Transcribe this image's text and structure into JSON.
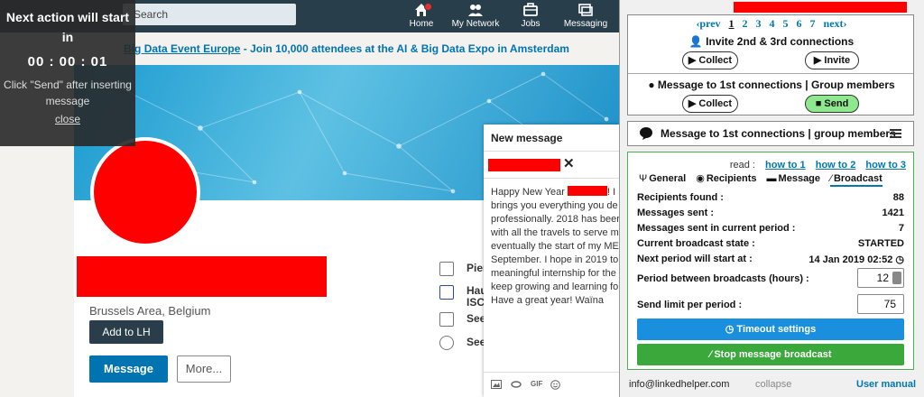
{
  "topnav": {
    "search_text": "Search",
    "items": [
      {
        "label": "Home",
        "icon": "home-icon"
      },
      {
        "label": "My Network",
        "icon": "network-icon"
      },
      {
        "label": "Jobs",
        "icon": "briefcase-icon"
      },
      {
        "label": "Messaging",
        "icon": "messaging-icon"
      }
    ]
  },
  "ad": {
    "link_text": "Big Data Event Europe",
    "text": " - Join 10,000 attendees at the AI & Big Data Expo in Amsterdam"
  },
  "timer": {
    "title": "Next action will start in",
    "countdown": "00 : 00 : 01",
    "note": "Click \"Send\" after inserting message",
    "close_label": "close"
  },
  "profile": {
    "location": "Brussels Area, Belgium",
    "add_to_lh_label": "Add to LH",
    "message_label": "Message",
    "more_label": "More...",
    "side_items": [
      "Pier",
      "Hau ISC",
      "See",
      "See"
    ]
  },
  "message_window": {
    "title": "New message",
    "close_glyph": "✕",
    "body_lines": [
      {
        "pre": "Happy New Year ",
        "post": "! I"
      },
      {
        "text": "brings you everything you de"
      },
      {
        "text": "professionally. 2018 has beer"
      },
      {
        "text": "with all the travels to serve m"
      },
      {
        "text": "eventually the start of my ME"
      },
      {
        "text": "September. I hope in 2019 to"
      },
      {
        "text": "meaningful internship for the"
      },
      {
        "text": "keep growing and learning fo"
      },
      {
        "text": "Have a great year! Waïna"
      }
    ],
    "footer_icons": [
      "attach-icon",
      "link-icon",
      "gif-icon",
      "emoji-icon"
    ],
    "gif_label": "GIF"
  },
  "linked_helper": {
    "pager": {
      "prev": "‹prev",
      "pages": [
        "1",
        "2",
        "3",
        "4",
        "5",
        "6",
        "7"
      ],
      "next": "next›",
      "current": "1"
    },
    "invite_section": {
      "title": "Invite 2nd & 3rd connections",
      "collect_label": "▶ Collect",
      "invite_label": "▶ Invite"
    },
    "message_section": {
      "title": "Message to 1st connections | Group members",
      "collect_label": "▶ Collect",
      "send_label": "■ Send"
    },
    "collapsed_header": {
      "title": "Message to 1st connections | group members"
    },
    "read_label": "read :",
    "how_to_links": [
      "how to 1",
      "how to 2",
      "how to 3"
    ],
    "tabs": [
      {
        "label": "General",
        "icon": "Ψ"
      },
      {
        "label": "Recipients",
        "icon": "◉"
      },
      {
        "label": "Message",
        "icon": "▬"
      },
      {
        "label": "Broadcast",
        "icon": "⁄"
      }
    ],
    "stats": [
      {
        "label": "Recipients found :",
        "value": "88"
      },
      {
        "label": "Messages sent :",
        "value": "1421"
      },
      {
        "label": "Messages sent in current period :",
        "value": "7"
      },
      {
        "label": "Current broadcast state :",
        "value": "STARTED"
      },
      {
        "label": "Next period will start at :",
        "value": "14 Jan 2019 02:52 ◷"
      }
    ],
    "period_label": "Period between broadcasts (hours) :",
    "period_value": "12",
    "limit_label": "Send limit per period :",
    "limit_value": "75",
    "timeout_button": "◷ Timeout settings",
    "stop_button": "Stop message broadcast",
    "footer": {
      "email": "info@linkedhelper.com",
      "collapse": "collapse",
      "manual": "User manual"
    }
  },
  "colors": {
    "linkedin_blue": "#0073b1",
    "nav_dark": "#283e4a",
    "redaction": "#ff0000",
    "send_green": "#8ee88e",
    "stop_green": "#3aa83a",
    "timeout_blue": "#1a8fdd"
  }
}
